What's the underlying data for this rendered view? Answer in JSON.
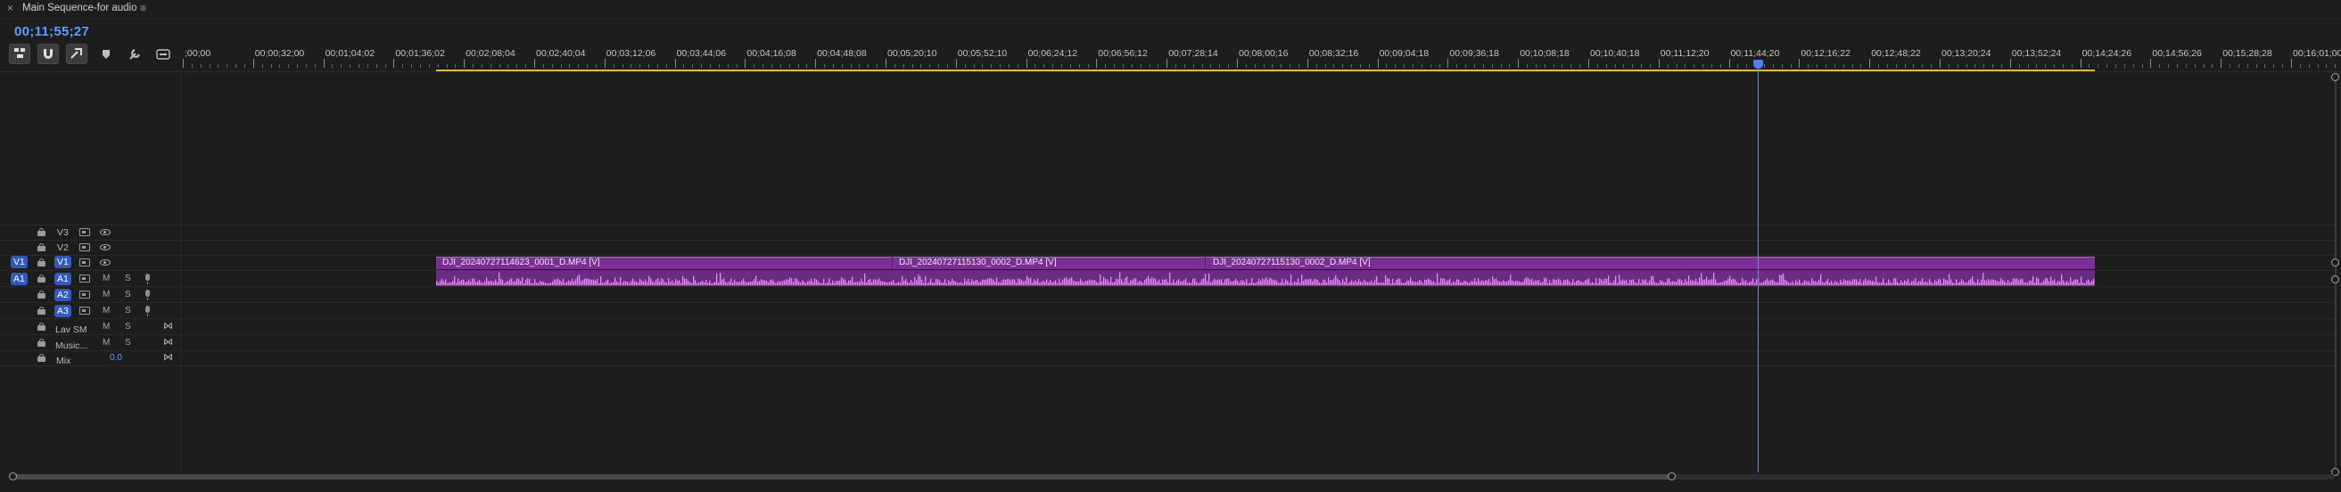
{
  "panel": {
    "close_label": "×",
    "title": "Main Sequence-for audio",
    "menu_label": "≡",
    "timecode": "00;11;55;27"
  },
  "toolbar": {
    "buttons": [
      {
        "name": "nest-toggle",
        "icon": "nest-icon",
        "active": true
      },
      {
        "name": "snap-toggle",
        "icon": "magnet-icon",
        "active": true
      },
      {
        "name": "linked-selection",
        "icon": "link-icon",
        "active": true
      },
      {
        "name": "add-marker",
        "icon": "marker-icon",
        "active": false
      },
      {
        "name": "timeline-settings",
        "icon": "wrench-icon",
        "active": false
      },
      {
        "name": "captions",
        "icon": "captions-icon",
        "active": false
      }
    ]
  },
  "ruler": {
    "ticks": [
      "00;00",
      "00;00;32;00",
      "00;01;04;02",
      "00;01;36;02",
      "00;02;08;04",
      "00;02;40;04",
      "00;03;12;06",
      "00;03;44;06",
      "00;04;16;08",
      "00;04;48;08",
      "00;05;20;10",
      "00;05;52;10",
      "00;06;24;12",
      "00;06;56;12",
      "00;07;28;14",
      "00;08;00;16",
      "00;08;32;16",
      "00;09;04;18",
      "00;09;36;18",
      "00;10;08;18",
      "00;10;40;18",
      "00;11;12;20",
      "00;11;44;20",
      "00;12;16;22",
      "00;12;48;22",
      "00;13;20;24",
      "00;13;52;24",
      "00;14;24;26",
      "00;14;56;26",
      "00;15;28;28",
      "00;16;01;00"
    ],
    "first_tick_display": ";00;00"
  },
  "tracks": {
    "video": [
      {
        "name": "V3",
        "selected": false
      },
      {
        "name": "V2",
        "selected": false
      },
      {
        "name": "V1",
        "selected": true,
        "source_patch": "V1"
      }
    ],
    "audio": [
      {
        "name": "A1",
        "source_patch": "A1",
        "mute": "M",
        "solo": "S"
      },
      {
        "name": "A2",
        "mute": "M",
        "solo": "S"
      },
      {
        "name": "A3",
        "mute": "M",
        "solo": "S"
      }
    ],
    "submix": [
      {
        "name": "Lav SM",
        "mute": "M",
        "solo": "S"
      },
      {
        "name": "Music...",
        "mute": "M",
        "solo": "S"
      }
    ],
    "mix": {
      "name": "Mix",
      "value": "0.0"
    }
  },
  "clips": [
    {
      "label": "DJI_20240727114623_0001_D.MP4 [V]"
    },
    {
      "label": "DJI_20240727115130_0002_D.MP4 [V]"
    },
    {
      "label": "DJI_20240727115130_0002_D.MP4 [V]"
    }
  ],
  "colors": {
    "timecode": "#5aa0ff",
    "clip_video": "#7b2f92",
    "clip_audio": "#6a2b84",
    "waveform": "#e58df5",
    "work_area": "#e2b93a",
    "playhead": "#4e82f0",
    "track_selected": "#2f5bbf"
  }
}
